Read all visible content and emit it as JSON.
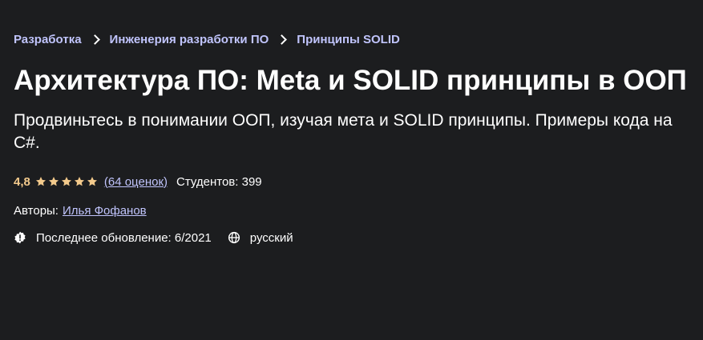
{
  "breadcrumb": {
    "items": [
      {
        "label": "Разработка"
      },
      {
        "label": "Инженерия разработки ПО"
      },
      {
        "label": "Принципы SOLID"
      }
    ]
  },
  "course": {
    "title": "Архитектура ПО: Meta и SOLID принципы в ООП",
    "subtitle": "Продвиньтесь в понимании ООП, изучая мета и SOLID принципы. Примеры кода на C#.",
    "rating": {
      "value": "4,8",
      "stars": 5,
      "reviews_label": "(64 оценок)"
    },
    "students_label": "Студентов: 399",
    "authors": {
      "label": "Авторы:",
      "name": "Илья Фофанов"
    },
    "last_updated": "Последнее обновление: 6/2021",
    "language": "русский"
  },
  "colors": {
    "background": "#1c1d1f",
    "link": "#c0c4fc",
    "rating": "#f3ca8c",
    "text": "#ffffff"
  },
  "icons": {
    "star": "star-icon",
    "update": "alert-badge-icon",
    "language": "globe-icon"
  }
}
